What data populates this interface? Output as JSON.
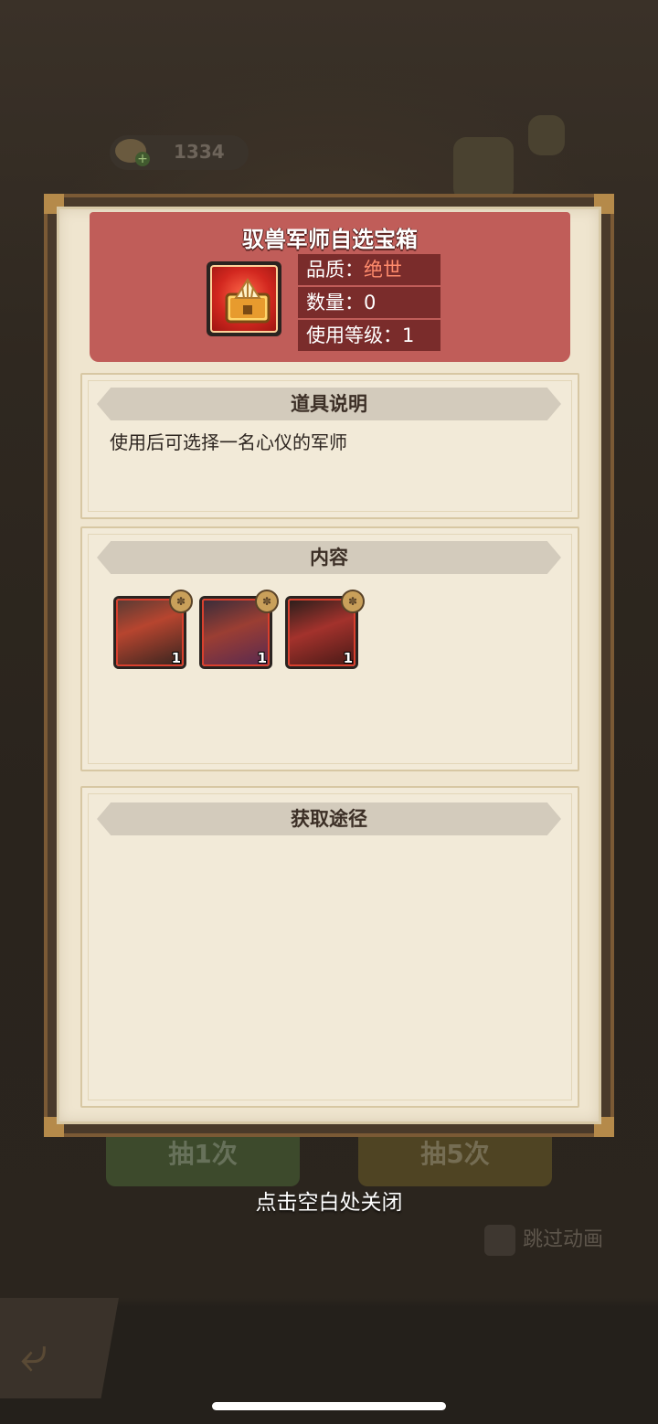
{
  "background": {
    "currency_amount": "1334",
    "draw_once_label": "抽1次",
    "draw_five_label": "抽5次",
    "skip_animation_label": "跳过动画"
  },
  "item": {
    "name": "驭兽军师自选宝箱",
    "quality_label": "品质：",
    "quality_value": "绝世",
    "quantity_label": "数量：0",
    "use_level_label": "使用等级：1",
    "icon": "treasure-chest-icon"
  },
  "sections": {
    "description_title": "道具说明",
    "description_text": "使用后可选择一名心仪的军师",
    "contents_title": "内容",
    "source_title": "获取途径"
  },
  "contents": [
    {
      "name": "hero-1",
      "count": "1",
      "color": "#b7452f"
    },
    {
      "name": "hero-2",
      "count": "1",
      "color": "#9b3e33"
    },
    {
      "name": "hero-3",
      "count": "1",
      "color": "#a3322c"
    }
  ],
  "close_hint": "点击空白处关闭"
}
